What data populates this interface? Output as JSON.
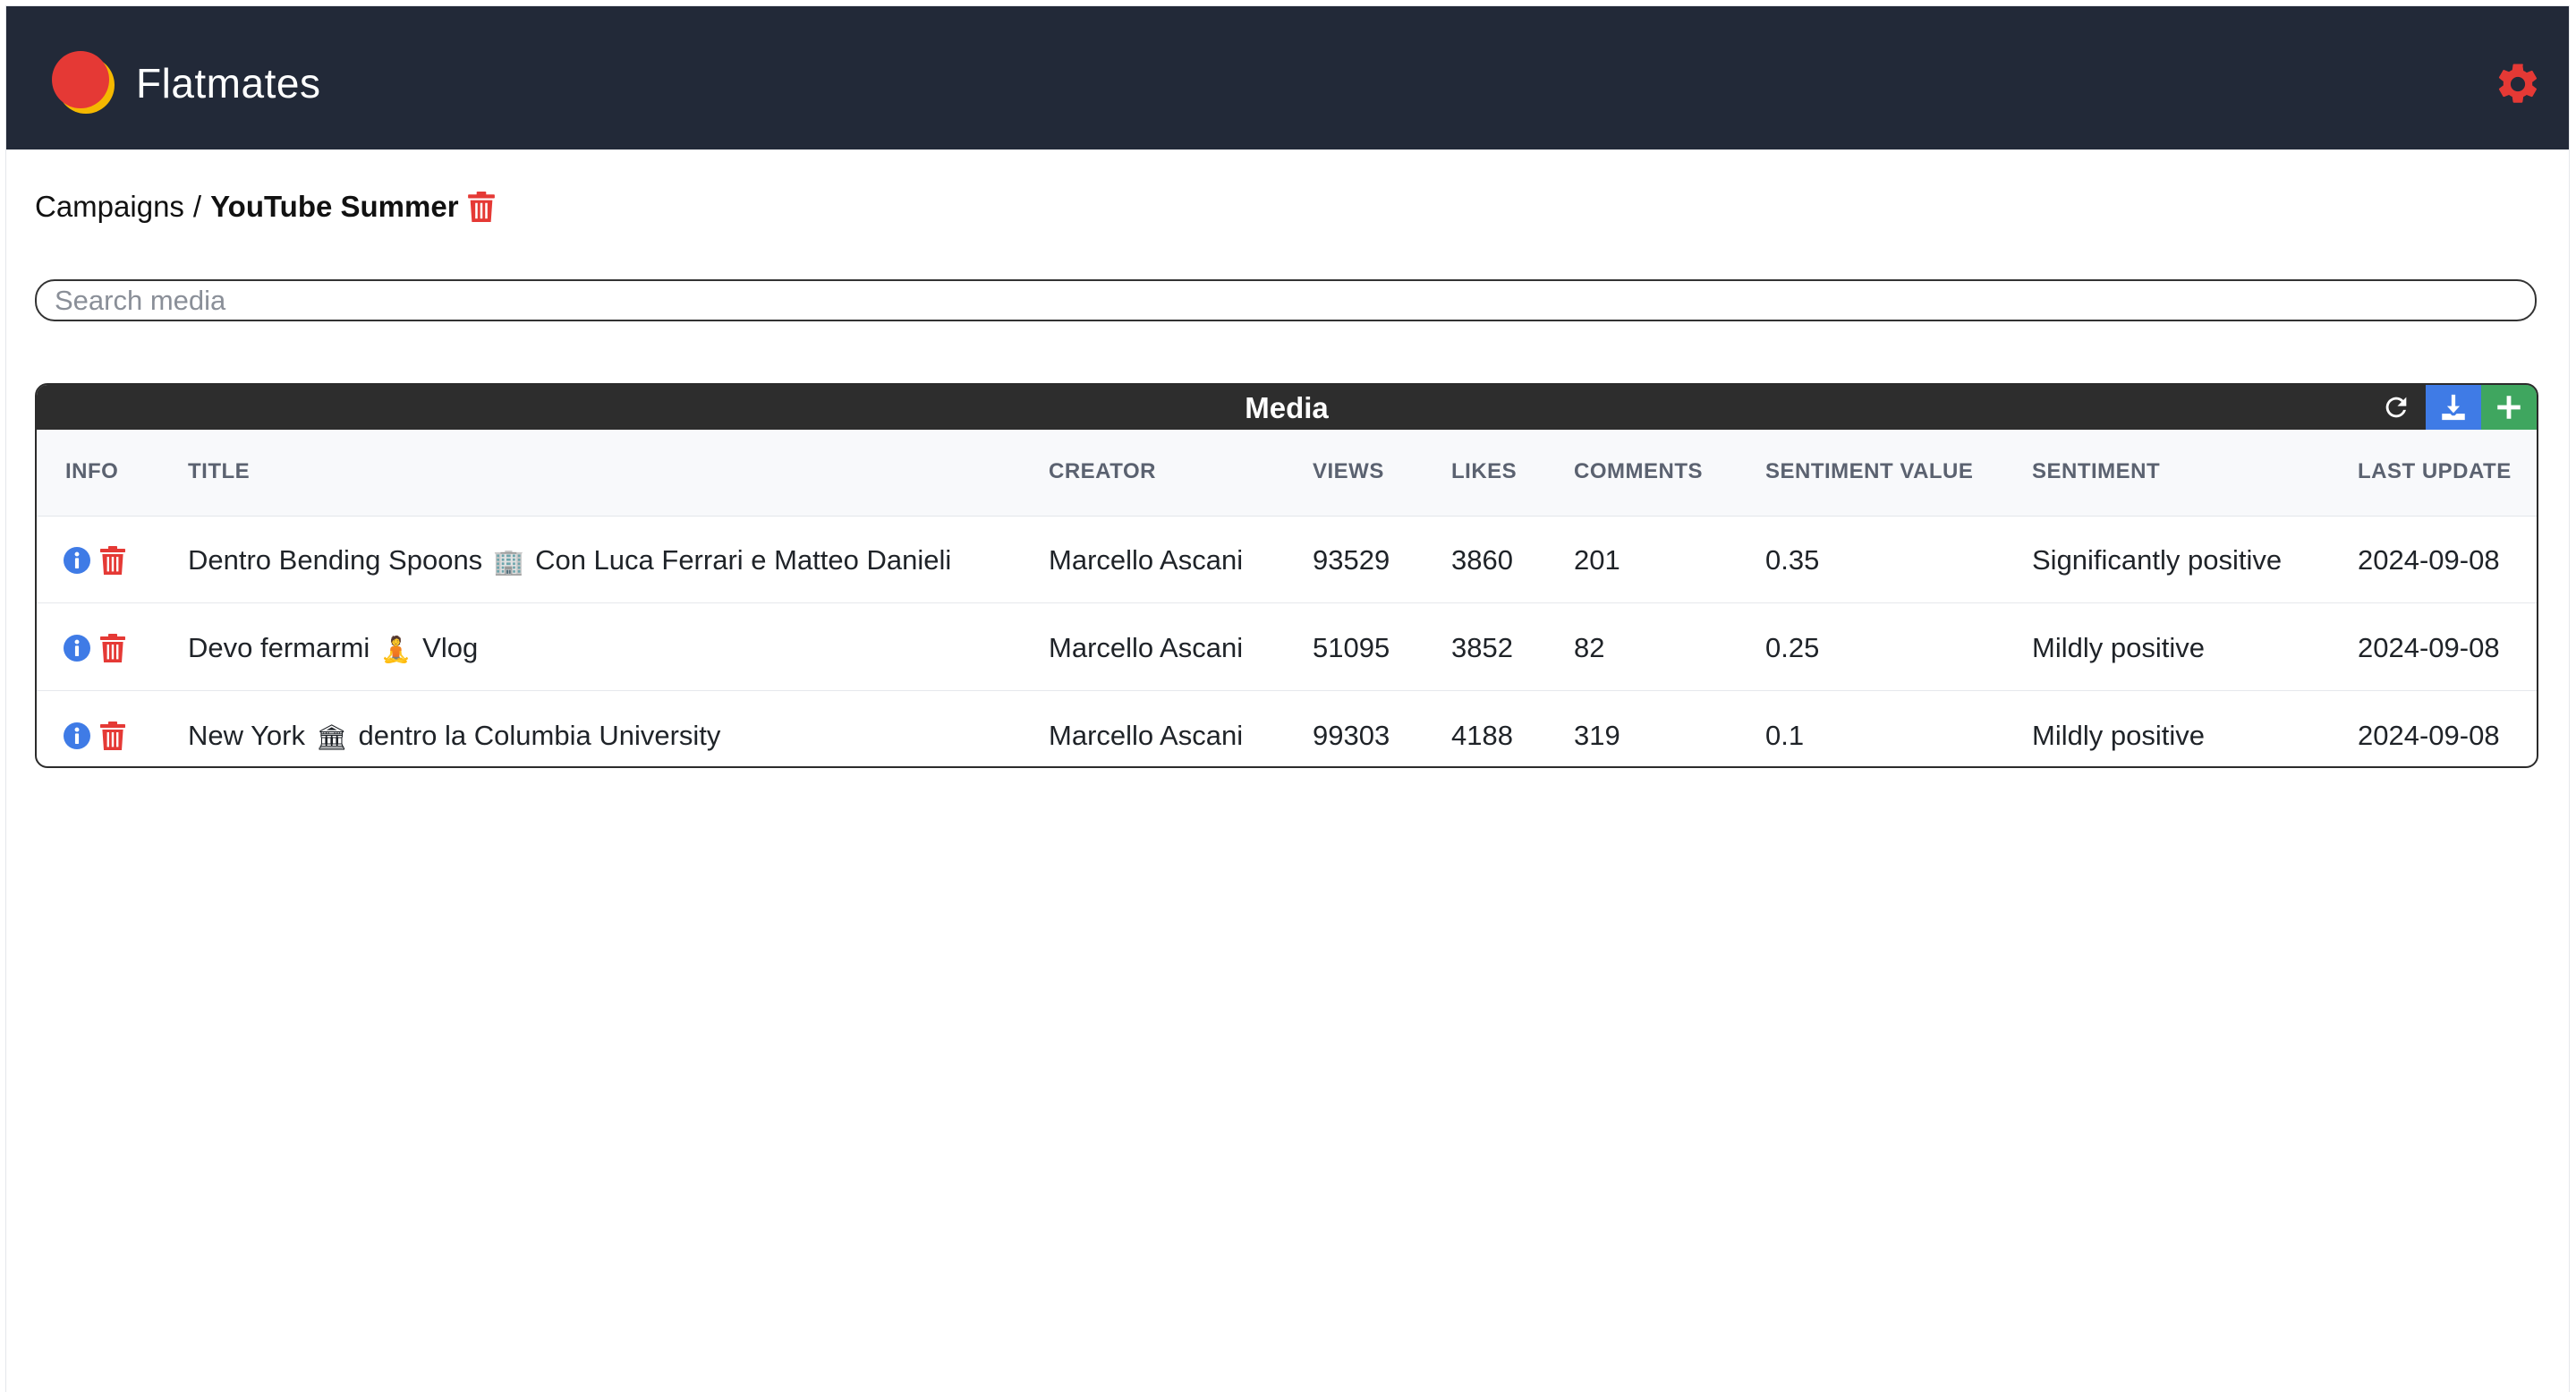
{
  "app": {
    "title": "Flatmates"
  },
  "icons": {
    "logo": "logo-icon",
    "settings": "gear-icon",
    "trash": "trash-icon",
    "info": "info-icon",
    "refresh": "refresh-icon",
    "download": "download-icon",
    "add": "plus-icon"
  },
  "colors": {
    "header_bg": "#222938",
    "accent_red": "#e53935",
    "info_blue": "#3f7be6",
    "add_green": "#3fa65f"
  },
  "breadcrumb": {
    "parent": "Campaigns",
    "separator": "/",
    "current": "YouTube Summer"
  },
  "search": {
    "placeholder": "Search media",
    "value": ""
  },
  "media": {
    "title": "Media",
    "columns": {
      "info": "INFO",
      "title": "TITLE",
      "creator": "CREATOR",
      "views": "VIEWS",
      "likes": "LIKES",
      "comments": "COMMENTS",
      "sentiment_value": "SENTIMENT VALUE",
      "sentiment": "SENTIMENT",
      "last_update": "LAST UPDATE"
    },
    "rows": [
      {
        "title_a": "Dentro Bending Spoons",
        "emoji": "🏢",
        "title_b": "Con Luca Ferrari e Matteo Danieli",
        "creator": "Marcello Ascani",
        "views": "93529",
        "likes": "3860",
        "comments": "201",
        "sentiment_value": "0.35",
        "sentiment": "Significantly positive",
        "last_update": "2024-09-08"
      },
      {
        "title_a": "Devo fermarmi",
        "emoji": "🧘",
        "title_b": "Vlog",
        "creator": "Marcello Ascani",
        "views": "51095",
        "likes": "3852",
        "comments": "82",
        "sentiment_value": "0.25",
        "sentiment": "Mildly positive",
        "last_update": "2024-09-08"
      },
      {
        "title_a": "New York",
        "emoji": "🏛",
        "title_b": "dentro la Columbia University",
        "creator": "Marcello Ascani",
        "views": "99303",
        "likes": "4188",
        "comments": "319",
        "sentiment_value": "0.1",
        "sentiment": "Mildly positive",
        "last_update": "2024-09-08"
      }
    ]
  }
}
